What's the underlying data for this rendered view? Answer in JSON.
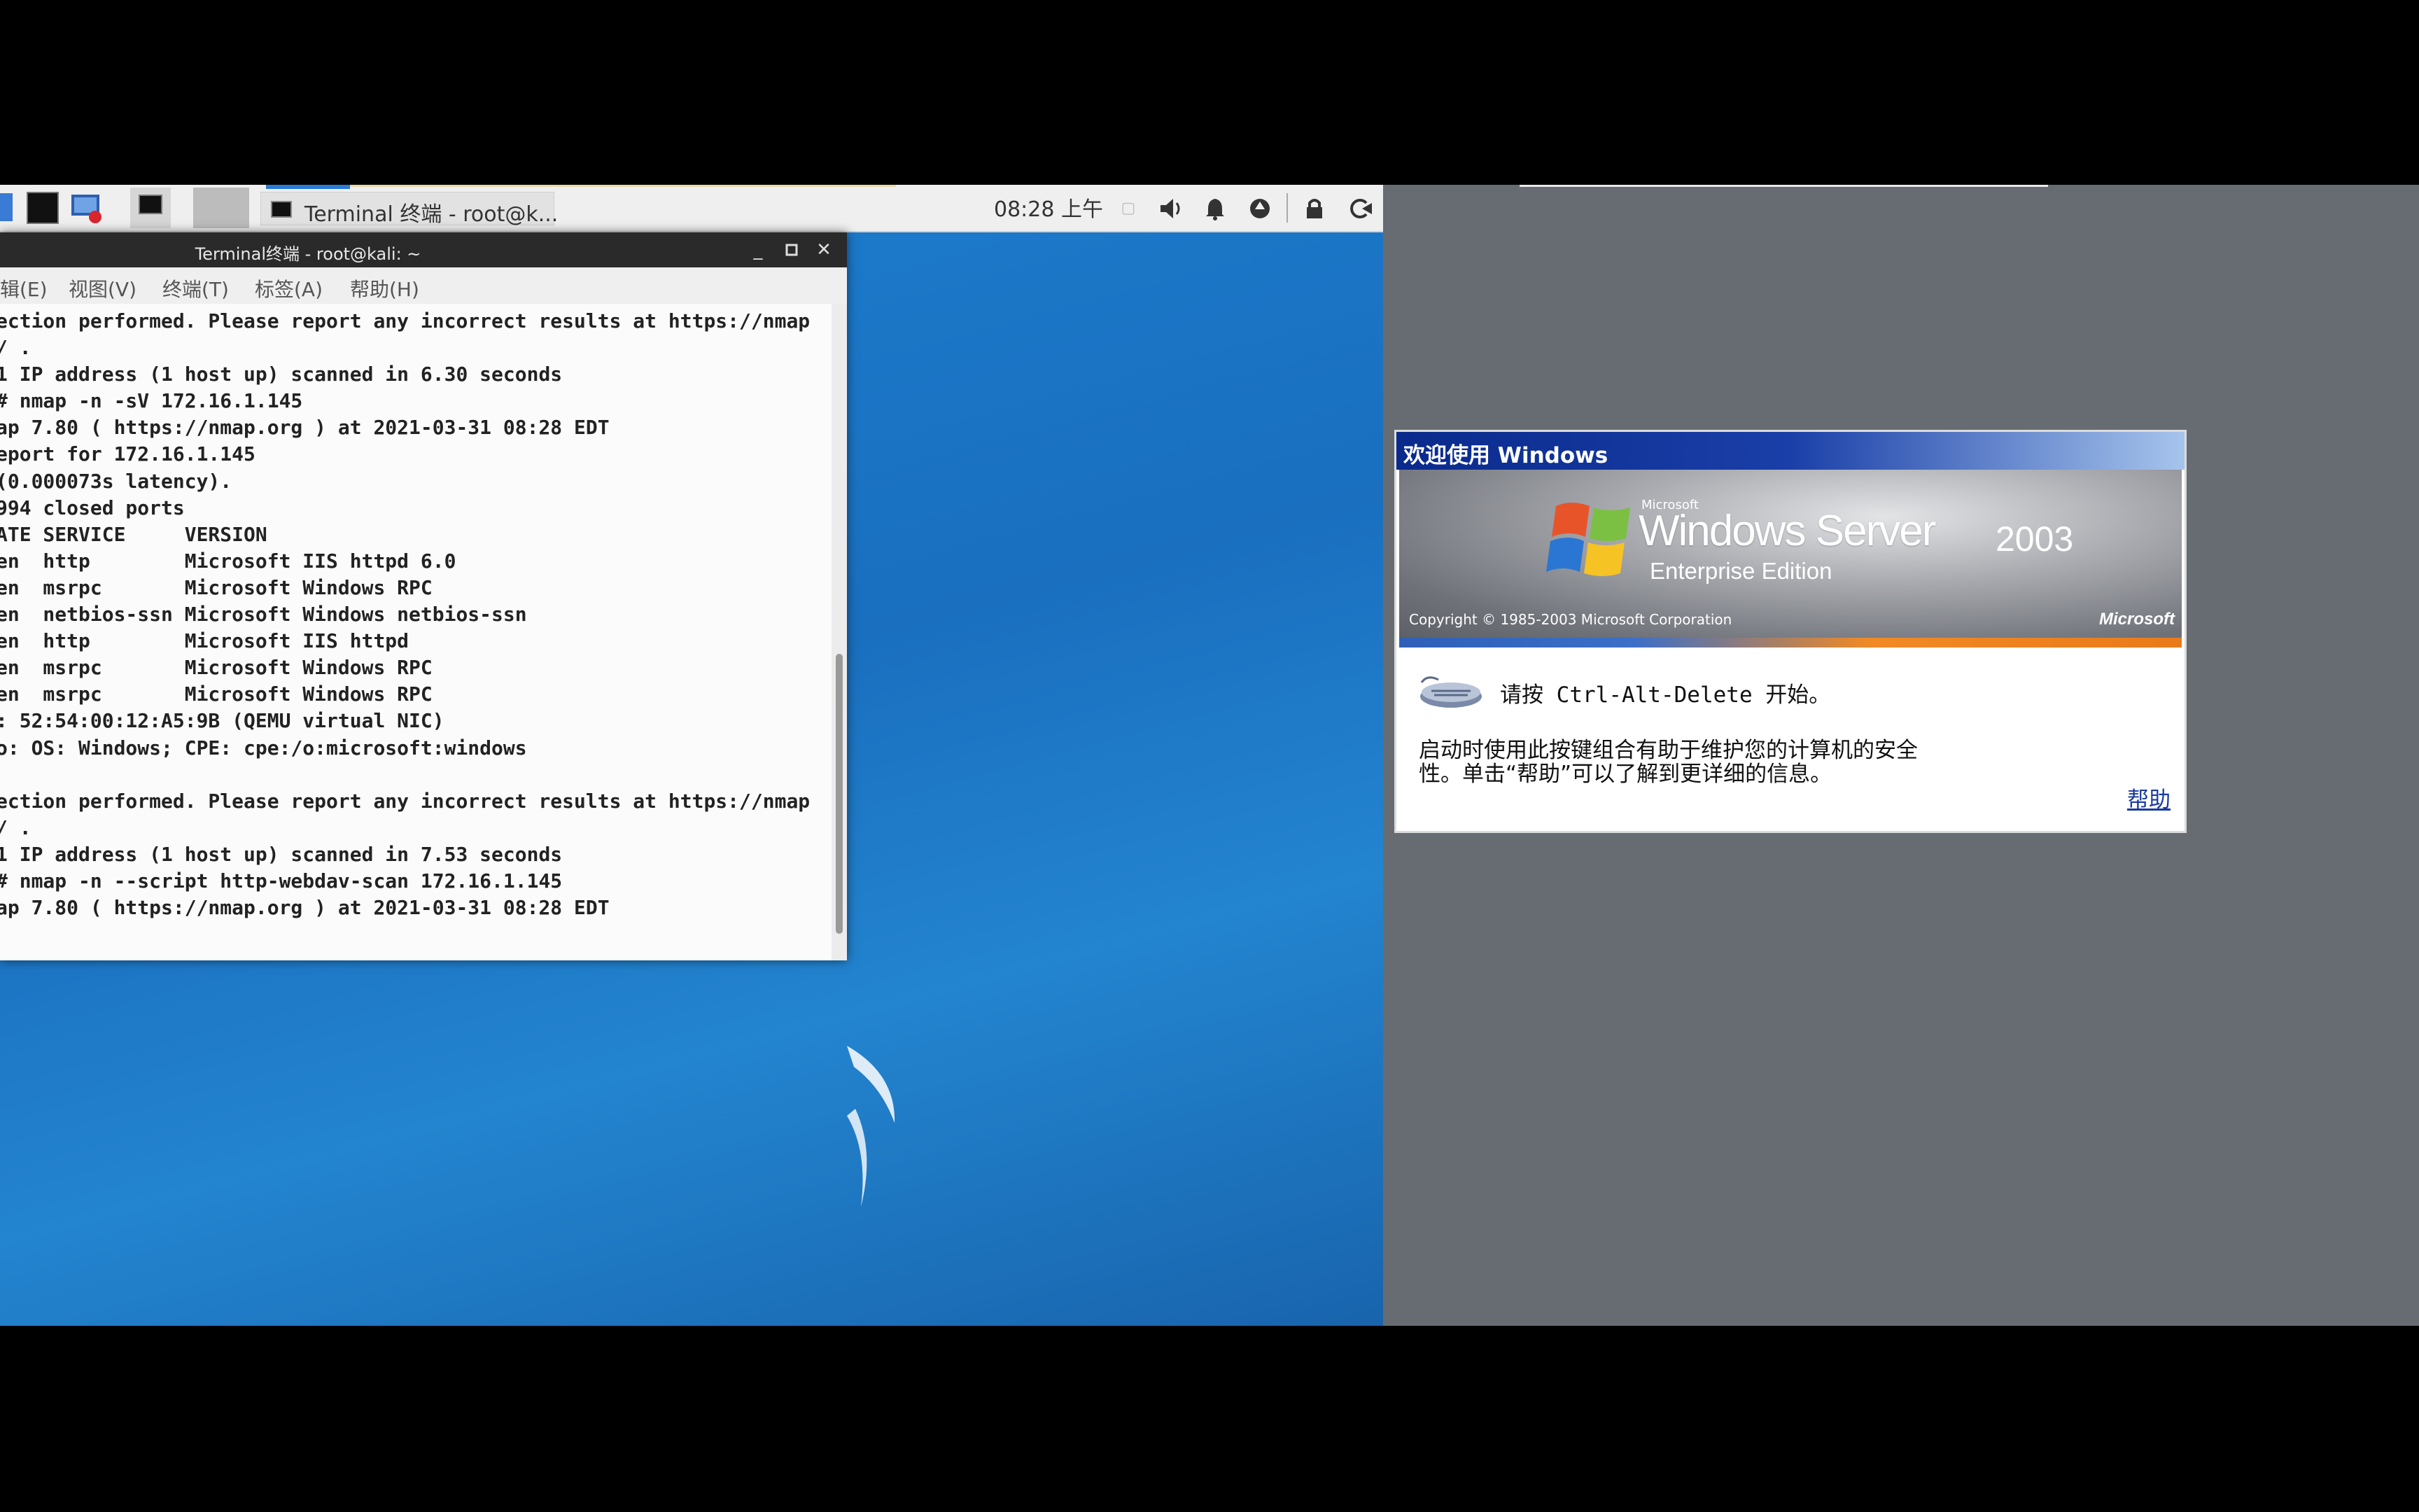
{
  "kali": {
    "panel": {
      "task_label": "Terminal 终端 - root@k...",
      "clock": "08:28 上午"
    },
    "terminal": {
      "title": "Terminal终端 - root@kali: ~",
      "menu": [
        "辑(E)",
        "视图(V)",
        "终端(T)",
        "标签(A)",
        "帮助(H)"
      ],
      "lines": [
        "ection performed. Please report any incorrect results at https://nmap",
        "/ .",
        "1 IP address (1 host up) scanned in 6.30 seconds",
        "# nmap -n -sV 172.16.1.145",
        "ap 7.80 ( https://nmap.org ) at 2021-03-31 08:28 EDT",
        "eport for 172.16.1.145",
        "(0.000073s latency).",
        "994 closed ports",
        "ATE SERVICE     VERSION",
        "en  http        Microsoft IIS httpd 6.0",
        "en  msrpc       Microsoft Windows RPC",
        "en  netbios-ssn Microsoft Windows netbios-ssn",
        "en  http        Microsoft IIS httpd",
        "en  msrpc       Microsoft Windows RPC",
        "en  msrpc       Microsoft Windows RPC",
        ": 52:54:00:12:A5:9B (QEMU virtual NIC)",
        "o: OS: Windows; CPE: cpe:/o:microsoft:windows",
        "",
        "ection performed. Please report any incorrect results at https://nmap",
        "/ .",
        "1 IP address (1 host up) scanned in 7.53 seconds",
        "# nmap -n --script http-webdav-scan 172.16.1.145",
        "ap 7.80 ( https://nmap.org ) at 2021-03-31 08:28 EDT"
      ]
    }
  },
  "windows": {
    "dialog": {
      "title": "欢迎使用 Windows",
      "ms_small": "Microsoft",
      "product": "Windows Server",
      "year": "2003",
      "edition": "Enterprise Edition",
      "copyright": "Copyright © 1985-2003  Microsoft Corporation",
      "ms_logo": "Microsoft",
      "prompt": "请按 Ctrl-Alt-Delete 开始。",
      "desc": "启动时使用此按键组合有助于维护您的计算机的安全性。单击“帮助”可以了解到更详细的信息。",
      "help": "帮助"
    }
  },
  "colors": {
    "kali_desktop": "#1a76c4",
    "windows_desktop": "#666c72",
    "dialog_title": "#0a2a8c"
  }
}
